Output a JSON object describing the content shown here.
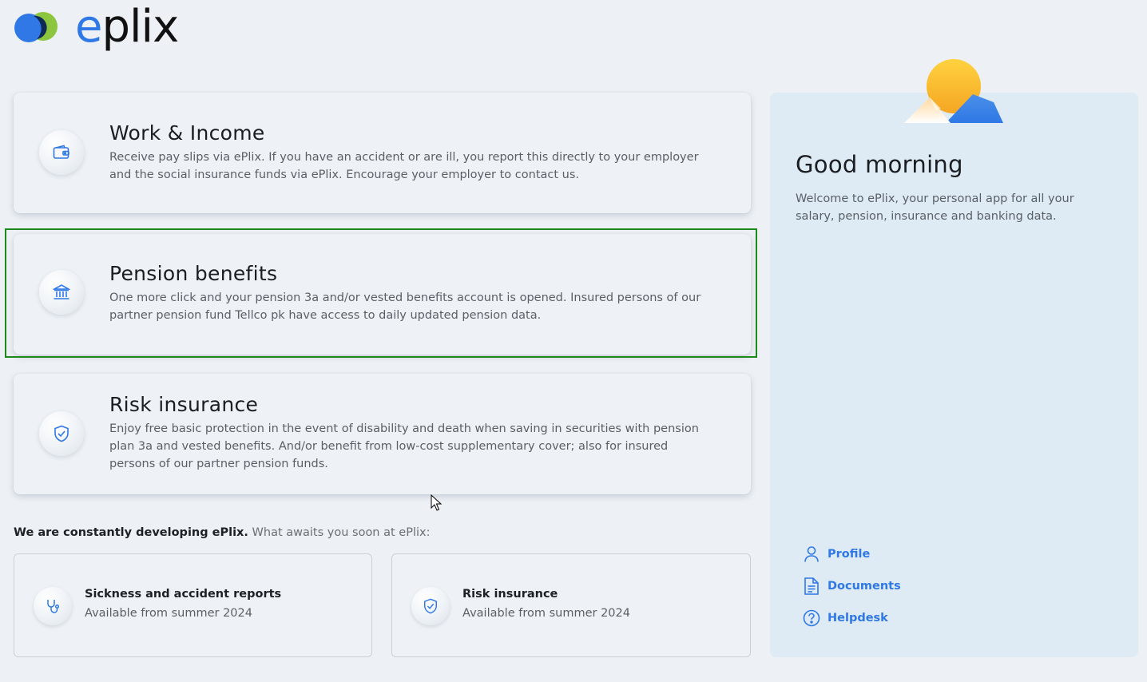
{
  "logo": {
    "text_e": "e",
    "text_rest": "plix"
  },
  "cards": [
    {
      "title": "Work & Income",
      "description": "Receive pay slips via ePlix. If you have an accident or are ill, you report this directly to your employer and the social insurance funds via ePlix. Encourage your employer to contact us.",
      "icon": "wallet-icon"
    },
    {
      "title": "Pension benefits",
      "description": "One more click and your pension 3a and/or vested benefits account is opened. Insured persons of our partner pension fund Tellco pk have access to daily updated pension data.",
      "icon": "bank-icon"
    },
    {
      "title": "Risk insurance",
      "description": "Enjoy free basic protection in the event of disability and death when saving in securities with pension plan 3a and vested benefits. And/or benefit from low-cost supplementary cover; also for insured persons of our partner pension funds.",
      "icon": "shield-check-icon"
    }
  ],
  "dev_notice": {
    "bold": "We are constantly developing ePlix.",
    "rest": " What awaits you soon at ePlix:"
  },
  "coming_soon": [
    {
      "title": "Sickness and accident reports",
      "subtitle": "Available from summer 2024",
      "icon": "stethoscope-icon"
    },
    {
      "title": "Risk insurance",
      "subtitle": "Available from summer 2024",
      "icon": "shield-check-icon"
    }
  ],
  "panel": {
    "greeting": "Good morning",
    "welcome": "Welcome to ePlix, your personal app for all your salary, pension, insurance and banking data.",
    "links": [
      {
        "label": "Profile",
        "icon": "user-icon"
      },
      {
        "label": "Documents",
        "icon": "document-icon"
      },
      {
        "label": "Helpdesk",
        "icon": "help-circle-icon"
      }
    ]
  },
  "colors": {
    "accent": "#2f78e6",
    "background": "#edf1f5",
    "panel": "#deebf4",
    "focus_outline": "#1b8a1b"
  }
}
